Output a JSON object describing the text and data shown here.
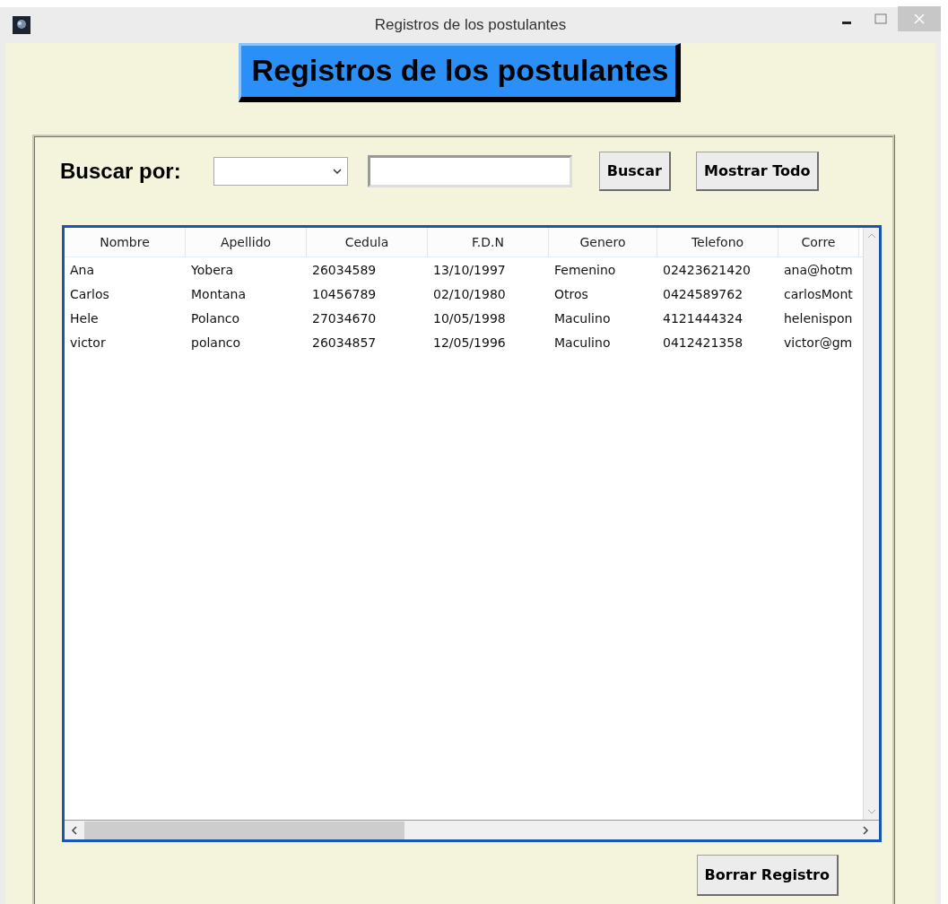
{
  "window": {
    "title": "Registros de los postulantes"
  },
  "banner": "Registros de los postulantes",
  "search": {
    "label": "Buscar por:",
    "buttons": [
      "Buscar",
      "Mostrar Todo"
    ]
  },
  "table": {
    "columns": [
      "Nombre",
      "Apellido",
      "Cedula",
      "F.D.N",
      "Genero",
      "Telefono",
      "Corre"
    ],
    "rows": [
      [
        "Ana",
        "Yobera",
        "26034589",
        "13/10/1997",
        "Femenino",
        "02423621420",
        "ana@hotm"
      ],
      [
        "Carlos",
        "Montana",
        "10456789",
        "02/10/1980",
        "Otros",
        "0424589762",
        "carlosMont"
      ],
      [
        "Hele",
        "Polanco",
        "27034670",
        "10/05/1998",
        "Maculino",
        "4121444324",
        "helenispon"
      ],
      [
        "victor",
        "polanco",
        "26034857",
        "12/05/1996",
        "Maculino",
        "0412421358",
        "victor@gm"
      ]
    ]
  },
  "footer_button": "Borrar Registro"
}
